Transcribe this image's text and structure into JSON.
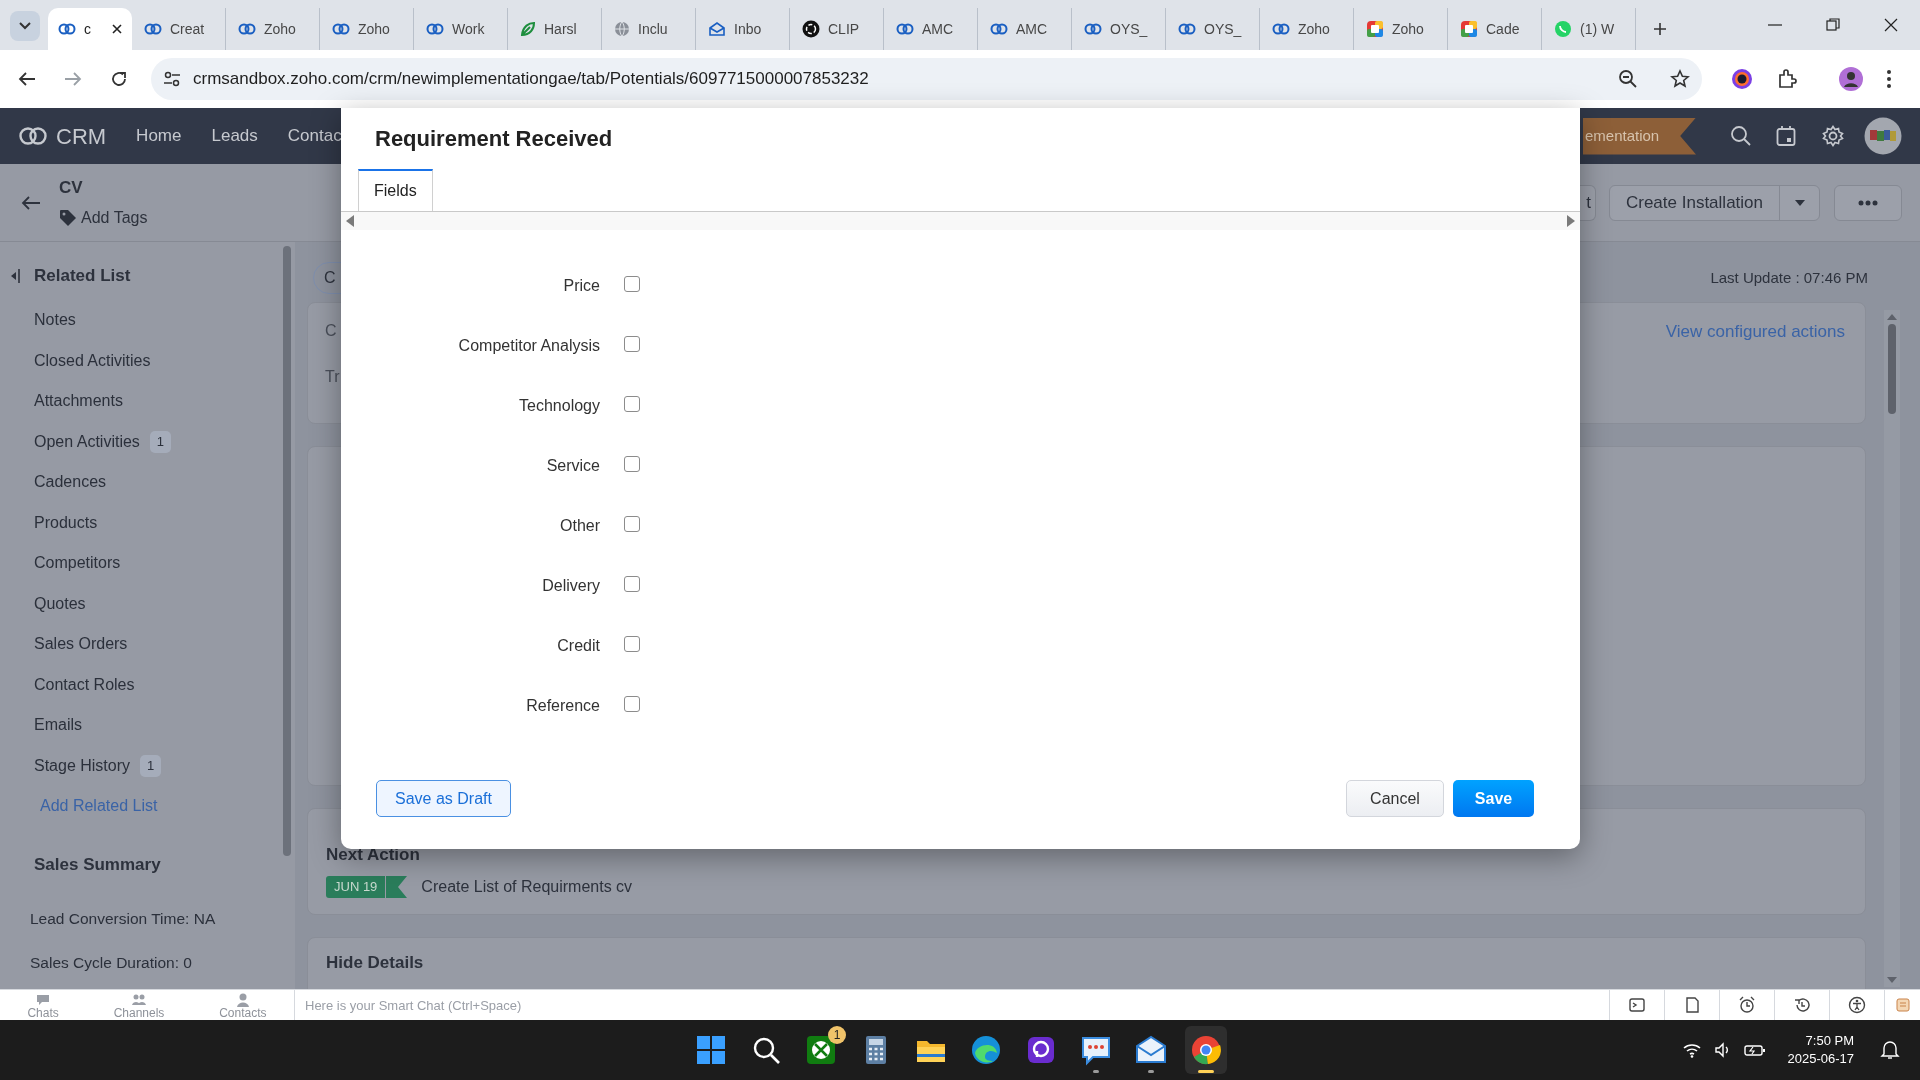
{
  "browser": {
    "tabs": [
      {
        "label": "c",
        "kind": "rings",
        "selected": true
      },
      {
        "label": "Creat",
        "kind": "rings",
        "selected": false
      },
      {
        "label": "Zoho",
        "kind": "rings",
        "selected": false
      },
      {
        "label": "Zoho",
        "kind": "rings",
        "selected": false
      },
      {
        "label": "Work",
        "kind": "rings",
        "selected": false
      },
      {
        "label": "Harsl",
        "kind": "leaf",
        "selected": false
      },
      {
        "label": "Inclu",
        "kind": "globe",
        "selected": false
      },
      {
        "label": "Inbo",
        "kind": "mail",
        "selected": false
      },
      {
        "label": "CLIP",
        "kind": "dark",
        "selected": false
      },
      {
        "label": "AMC",
        "kind": "rings",
        "selected": false
      },
      {
        "label": "AMC",
        "kind": "rings",
        "selected": false
      },
      {
        "label": "OYS_",
        "kind": "rings",
        "selected": false
      },
      {
        "label": "OYS_",
        "kind": "rings",
        "selected": false
      },
      {
        "label": "Zoho",
        "kind": "rings",
        "selected": false
      },
      {
        "label": "Zoho",
        "kind": "color",
        "selected": false
      },
      {
        "label": "Cade",
        "kind": "color",
        "selected": false
      },
      {
        "label": "(1) W",
        "kind": "chat",
        "selected": false
      }
    ],
    "url": "crmsandbox.zoho.com/crm/newimplementationgae/tab/Potentials/6097715000007853232"
  },
  "app_header": {
    "logo": "CRM",
    "nav": [
      "Home",
      "Leads",
      "Contac"
    ],
    "ribbon": "ementation"
  },
  "record": {
    "title": "CV",
    "add_tags": "Add Tags",
    "partial_button": "t",
    "create_button": "Create Installation"
  },
  "sidebar": {
    "heading": "Related List",
    "items": [
      {
        "label": "Notes"
      },
      {
        "label": "Closed Activities"
      },
      {
        "label": "Attachments"
      },
      {
        "label": "Open Activities",
        "count": "1"
      },
      {
        "label": "Cadences"
      },
      {
        "label": "Products"
      },
      {
        "label": "Competitors"
      },
      {
        "label": "Quotes"
      },
      {
        "label": "Sales Orders"
      },
      {
        "label": "Contact Roles"
      },
      {
        "label": "Emails"
      },
      {
        "label": "Stage History",
        "count": "1"
      }
    ],
    "add_link": "Add Related List",
    "summary_title": "Sales Summary",
    "summary_lines": [
      "Lead Conversion Time: NA",
      "Sales Cycle Duration: 0"
    ]
  },
  "main": {
    "pill": "C",
    "card_fragments": [
      "C",
      "Tr"
    ],
    "last_update": "Last Update : 07:46 PM",
    "actions_link": "View configured actions",
    "next_action": {
      "title": "Next Action",
      "date": "JUN 19",
      "task": "Create List of Requirments cv"
    },
    "hide_details": "Hide Details"
  },
  "dialog": {
    "title": "Requirement Received",
    "tabs": [
      {
        "label": "Fields",
        "selected": true
      }
    ],
    "fields": [
      {
        "label": "Price",
        "checked": false
      },
      {
        "label": "Competitor Analysis",
        "checked": false
      },
      {
        "label": "Technology",
        "checked": false
      },
      {
        "label": "Service",
        "checked": false
      },
      {
        "label": "Other",
        "checked": false
      },
      {
        "label": "Delivery",
        "checked": false
      },
      {
        "label": "Credit",
        "checked": false
      },
      {
        "label": "Reference",
        "checked": false
      }
    ],
    "draft_button": "Save as Draft",
    "cancel_button": "Cancel",
    "save_button": "Save"
  },
  "chat_bar": {
    "tabs": [
      "Chats",
      "Channels",
      "Contacts"
    ],
    "placeholder": "Here is your Smart Chat (Ctrl+Space)"
  },
  "taskbar": {
    "badge": "1",
    "time": "7:50 PM",
    "date": "2025-06-17"
  }
}
